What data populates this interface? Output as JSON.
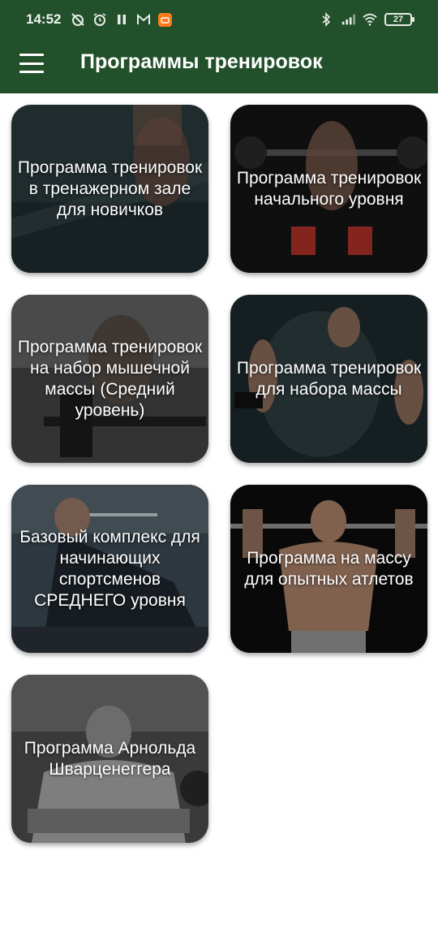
{
  "status_bar": {
    "time": "14:52",
    "battery": "27"
  },
  "app_bar": {
    "title": "Программы тренировок",
    "menu_icon": "hamburger-menu-icon",
    "background": "#21502a"
  },
  "programs": [
    {
      "title": "Программа тренировок в тренажерном зале для новичков"
    },
    {
      "title": "Программа тренировок начального уровня"
    },
    {
      "title": "Программа тренировок на набор мышечной массы (Средний уровень)"
    },
    {
      "title": "Программа тренировок для набора массы"
    },
    {
      "title": "Базовый комплекс для начинающих спортсменов СРЕДНЕГО уровня"
    },
    {
      "title": "Программа на массу для опытных атлетов"
    },
    {
      "title": "Программа Арнольда Шварценеггера"
    }
  ]
}
